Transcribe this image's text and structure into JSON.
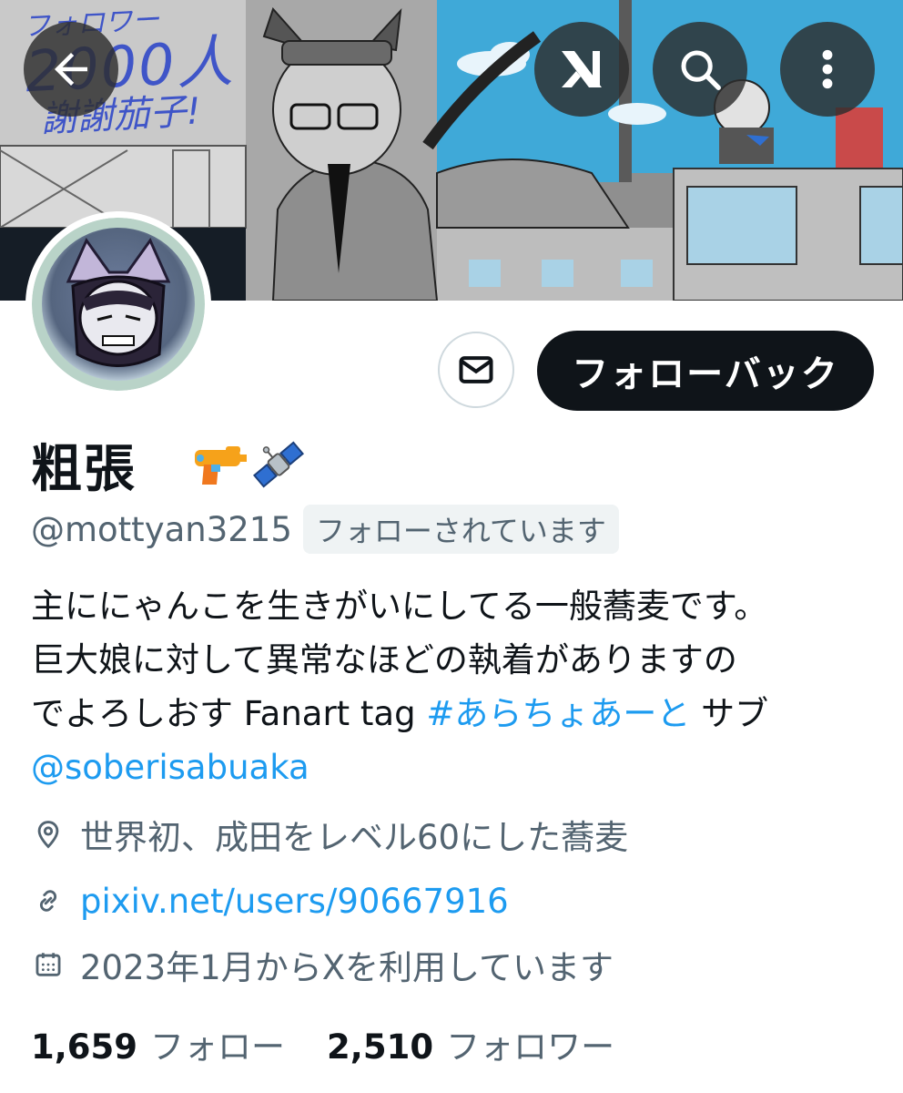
{
  "banner": {
    "overlay_text_line1": "フォロワー",
    "overlay_text_line2": "2000人",
    "overlay_text_line3": "謝謝茄子!"
  },
  "header": {
    "back_icon": "arrow-left-icon",
    "grok_icon": "grok-icon",
    "search_icon": "search-icon",
    "more_icon": "more-vertical-icon"
  },
  "actions": {
    "message_icon": "envelope-icon",
    "follow_back_label": "フォローバック"
  },
  "profile": {
    "display_name": "粗張",
    "name_emojis": [
      "🔫",
      "🛰️"
    ],
    "handle": "@mottyan3215",
    "follows_you_label": "フォローされています"
  },
  "bio": {
    "line1": "主ににゃんこを生きがいにしてる一般蕎麦です。",
    "line2": "巨大娘に対して異常なほどの執着がありますの",
    "line3_prefix": "でよろしおす Fanart tag ",
    "hashtag": "#あらちょあーと",
    "line3_suffix": " サブ",
    "mention": "@soberisabuaka"
  },
  "meta": {
    "location": "世界初、成田をレベル60にした蕎麦",
    "url": "pixiv.net/users/90667916",
    "joined": "2023年1月からXを利用しています"
  },
  "stats": {
    "following_count": "1,659",
    "following_label": "フォロー",
    "followers_count": "2,510",
    "followers_label": "フォロワー"
  },
  "colors": {
    "link": "#1d9bf0",
    "secondary_text": "#536471",
    "primary_text": "#0f1419",
    "button_dark": "#0f1419"
  }
}
